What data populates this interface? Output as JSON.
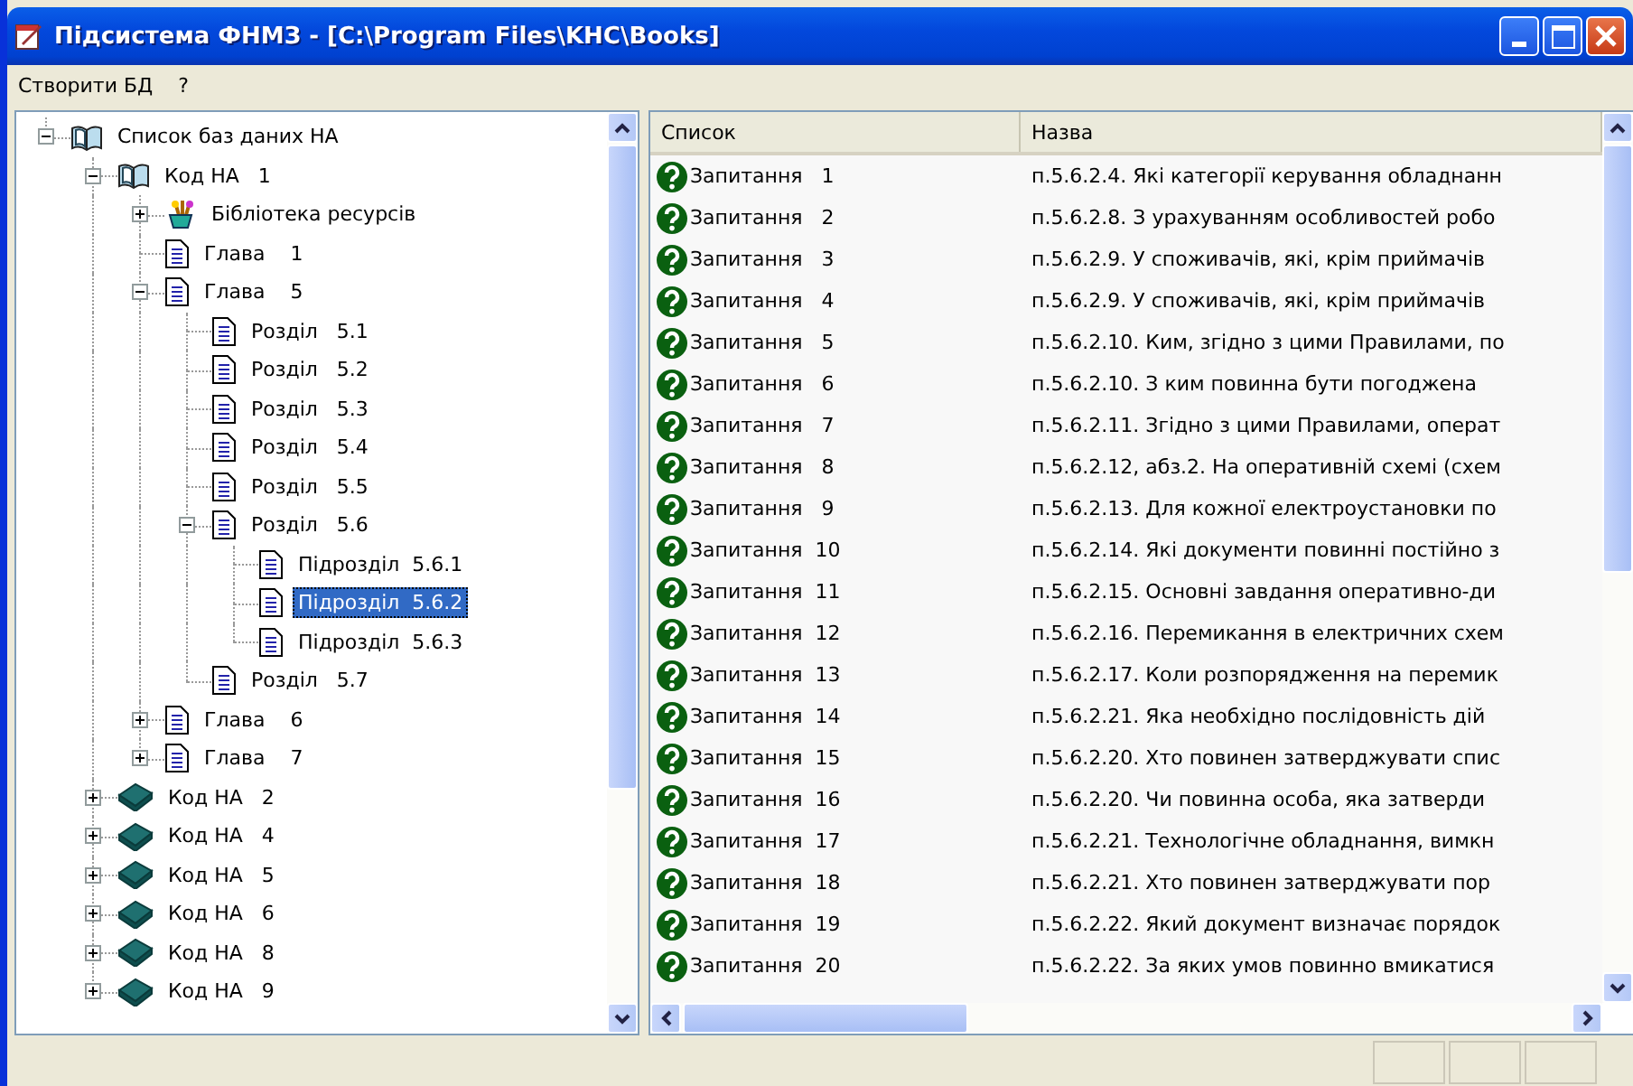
{
  "window": {
    "title": "Підсистема ФНМЗ - [C:\\Program Files\\KHC\\Books]"
  },
  "menu": [
    "Створити БД",
    "?"
  ],
  "tree": {
    "items": [
      {
        "label": "Список баз даних НА",
        "kind": "open-book",
        "expanded": true,
        "selected": false,
        "children": [
          {
            "label": "Код НА   1",
            "kind": "open-book",
            "expanded": true,
            "selected": false,
            "children": [
              {
                "label": "Бібліотека ресурсів",
                "kind": "resources",
                "expanded": false,
                "selected": false
              },
              {
                "label": "Глава    1",
                "kind": "page",
                "selected": false
              },
              {
                "label": "Глава    5",
                "kind": "page",
                "expanded": true,
                "selected": false,
                "children": [
                  {
                    "label": "Розділ   5.1",
                    "kind": "page",
                    "selected": false
                  },
                  {
                    "label": "Розділ   5.2",
                    "kind": "page",
                    "selected": false
                  },
                  {
                    "label": "Розділ   5.3",
                    "kind": "page",
                    "selected": false
                  },
                  {
                    "label": "Розділ   5.4",
                    "kind": "page",
                    "selected": false
                  },
                  {
                    "label": "Розділ   5.5",
                    "kind": "page",
                    "selected": false
                  },
                  {
                    "label": "Розділ   5.6",
                    "kind": "page",
                    "expanded": true,
                    "selected": false,
                    "children": [
                      {
                        "label": "Підрозділ  5.6.1",
                        "kind": "page",
                        "selected": false
                      },
                      {
                        "label": "Підрозділ  5.6.2",
                        "kind": "page",
                        "selected": true
                      },
                      {
                        "label": "Підрозділ  5.6.3",
                        "kind": "page",
                        "selected": false
                      }
                    ]
                  },
                  {
                    "label": "Розділ   5.7",
                    "kind": "page",
                    "selected": false
                  }
                ]
              },
              {
                "label": "Глава    6",
                "kind": "page",
                "expanded": false,
                "selected": false
              },
              {
                "label": "Глава    7",
                "kind": "page",
                "expanded": false,
                "selected": false
              }
            ]
          },
          {
            "label": "Код НА   2",
            "kind": "closed-book",
            "expanded": false,
            "selected": false
          },
          {
            "label": "Код НА   4",
            "kind": "closed-book",
            "expanded": false,
            "selected": false
          },
          {
            "label": "Код НА   5",
            "kind": "closed-book",
            "expanded": false,
            "selected": false
          },
          {
            "label": "Код НА   6",
            "kind": "closed-book",
            "expanded": false,
            "selected": false
          },
          {
            "label": "Код НА   8",
            "kind": "closed-book",
            "expanded": false,
            "selected": false
          },
          {
            "label": "Код НА   9",
            "kind": "closed-book",
            "expanded": false,
            "selected": false
          }
        ]
      }
    ]
  },
  "list": {
    "columns": [
      "Список",
      "Назва"
    ],
    "rows": [
      {
        "name": "Запитання   1",
        "title": "п.5.6.2.4. Які категорії керування обладнанн"
      },
      {
        "name": "Запитання   2",
        "title": "п.5.6.2.8. З урахуванням особливостей робо"
      },
      {
        "name": "Запитання   3",
        "title": "п.5.6.2.9. У споживачів, які, крім приймачів"
      },
      {
        "name": "Запитання   4",
        "title": "п.5.6.2.9. У споживачів, які, крім приймачів"
      },
      {
        "name": "Запитання   5",
        "title": "п.5.6.2.10. Ким, згідно з цими Правилами, по"
      },
      {
        "name": "Запитання   6",
        "title": "п.5.6.2.10. З ким повинна бути погоджена"
      },
      {
        "name": "Запитання   7",
        "title": "п.5.6.2.11. Згідно з цими Правилами, операт"
      },
      {
        "name": "Запитання   8",
        "title": "п.5.6.2.12, абз.2. На оперативній схемі (схем"
      },
      {
        "name": "Запитання   9",
        "title": "п.5.6.2.13. Для кожної електроустановки по"
      },
      {
        "name": "Запитання  10",
        "title": "п.5.6.2.14. Які документи повинні постійно з"
      },
      {
        "name": "Запитання  11",
        "title": "п.5.6.2.15. Основні завдання оперативно-ди"
      },
      {
        "name": "Запитання  12",
        "title": "п.5.6.2.16. Перемикання в електричних схем"
      },
      {
        "name": "Запитання  13",
        "title": "п.5.6.2.17. Коли розпорядження на перемик"
      },
      {
        "name": "Запитання  14",
        "title": "п.5.6.2.21. Яка необхідно послідовність дій"
      },
      {
        "name": "Запитання  15",
        "title": "п.5.6.2.20. Хто повинен затверджувати спис"
      },
      {
        "name": "Запитання  16",
        "title": "п.5.6.2.20. Чи повинна особа, яка затверди"
      },
      {
        "name": "Запитання  17",
        "title": "п.5.6.2.21. Технологічне обладнання, вимкн"
      },
      {
        "name": "Запитання  18",
        "title": "п.5.6.2.21. Хто повинен затверджувати пор"
      },
      {
        "name": "Запитання  19",
        "title": "п.5.6.2.22. Який документ визначає порядок"
      },
      {
        "name": "Запитання  20",
        "title": "п.5.6.2.22. За яких умов повинно вмикатися"
      }
    ]
  }
}
